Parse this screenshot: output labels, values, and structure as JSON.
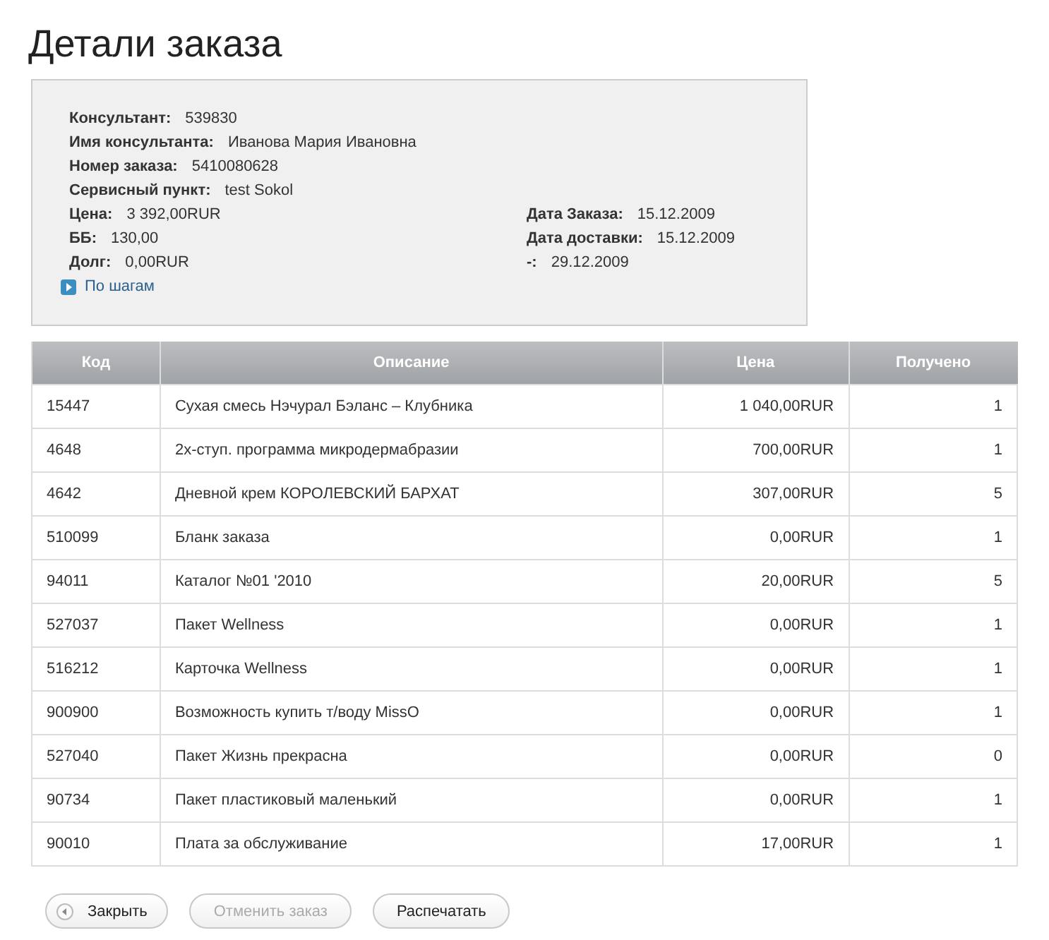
{
  "title": "Детали заказа",
  "info": {
    "left": [
      {
        "label": "Консультант:",
        "value": "539830"
      },
      {
        "label": "Имя консультанта:",
        "value": "Иванова Мария Ивановна"
      },
      {
        "label": "Номер заказа:",
        "value": "5410080628"
      },
      {
        "label": "Сервисный пункт:",
        "value": "test Sokol"
      },
      {
        "label": "Цена:",
        "value": "3 392,00RUR"
      },
      {
        "label": "ББ:",
        "value": "130,00"
      },
      {
        "label": "Долг:",
        "value": "0,00RUR"
      }
    ],
    "right": [
      {
        "label": "Дата Заказа:",
        "value": "15.12.2009"
      },
      {
        "label": "Дата доставки:",
        "value": "15.12.2009"
      },
      {
        "label": "-:",
        "value": "29.12.2009"
      }
    ],
    "link": "По шагам"
  },
  "table": {
    "columns": [
      "Код",
      "Описание",
      "Цена",
      "Получено"
    ],
    "rows": [
      [
        "15447",
        "Сухая смесь Нэчурал Бэланс – Клубника",
        "1 040,00RUR",
        "1"
      ],
      [
        "4648",
        "2х-ступ. программа микродермабразии",
        "700,00RUR",
        "1"
      ],
      [
        "4642",
        "Дневной крем КОРОЛЕВСКИЙ БАРХАТ",
        "307,00RUR",
        "5"
      ],
      [
        "510099",
        "Бланк заказа",
        "0,00RUR",
        "1"
      ],
      [
        "94011",
        "Каталог №01 '2010",
        "20,00RUR",
        "5"
      ],
      [
        "527037",
        "Пакет Wellness",
        "0,00RUR",
        "1"
      ],
      [
        "516212",
        "Карточка Wellness",
        "0,00RUR",
        "1"
      ],
      [
        "900900",
        "Возможность купить т/воду MissO",
        "0,00RUR",
        "1"
      ],
      [
        "527040",
        "Пакет Жизнь прекрасна",
        "0,00RUR",
        "0"
      ],
      [
        "90734",
        "Пакет пластиковый маленький",
        "0,00RUR",
        "1"
      ],
      [
        "90010",
        "Плата за обслуживание",
        "17,00RUR",
        "1"
      ]
    ]
  },
  "buttons": [
    {
      "label": "Закрыть",
      "kind": "back",
      "disabled": false
    },
    {
      "label": "Отменить заказ",
      "kind": "plain",
      "disabled": true
    },
    {
      "label": "Распечатать",
      "kind": "plain",
      "disabled": false
    }
  ]
}
